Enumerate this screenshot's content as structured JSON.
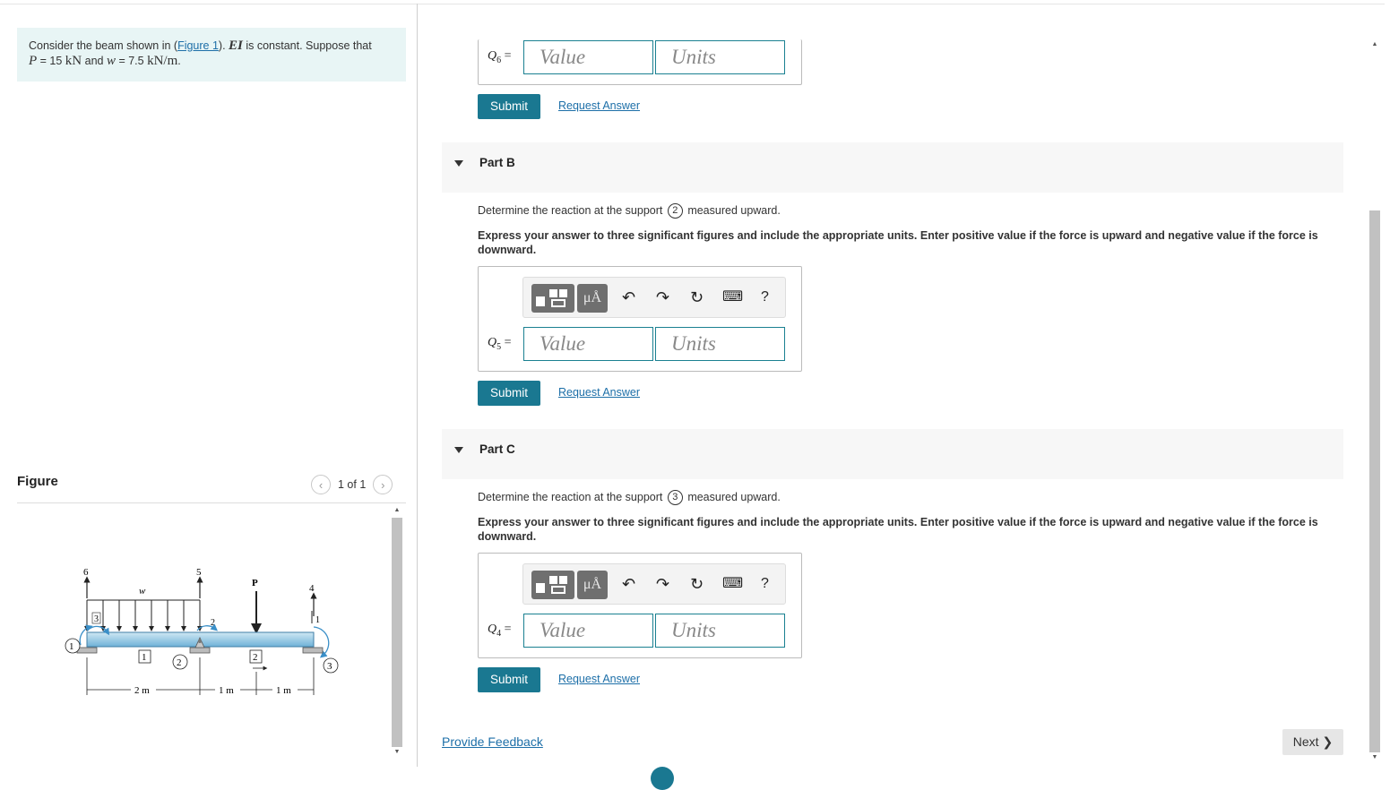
{
  "problem": {
    "text_prefix": "Consider the beam shown in (",
    "figure_link": "Figure 1",
    "text_mid": "). ",
    "ei": "EI",
    "text_constant": " is constant. Suppose that",
    "p_var": "P",
    "p_value": " = 15 ",
    "p_unit": "kN",
    "and_text": " and ",
    "w_var": "w",
    "w_value": " = 7.5 ",
    "w_unit": "kN/m",
    "end": "."
  },
  "figure": {
    "title": "Figure",
    "pager_text": "1 of 1",
    "prev_icon": "chevron-left-icon",
    "next_icon": "chevron-right-icon",
    "labels": {
      "node_6": "6",
      "node_5": "5",
      "node_4": "4",
      "node_3": "3",
      "node_2": "2",
      "node_1": "1",
      "w": "w",
      "P": "P",
      "support_1": "1",
      "support_2": "2",
      "support_3": "3",
      "elem_1": "1",
      "elem_2": "2",
      "dim_1": "2 m",
      "dim_2": "1 m",
      "dim_3": "1 m"
    }
  },
  "partA_tail": {
    "q_label": "Q",
    "q_sub": "6",
    "value_placeholder": "Value",
    "units_placeholder": "Units",
    "submit": "Submit",
    "request": "Request Answer"
  },
  "partB": {
    "title": "Part B",
    "q_pre": "Determine the reaction at the support ",
    "q_circ": "2",
    "q_post": " measured upward.",
    "instructions": "Express your answer to three significant figures and include the appropriate units. Enter positive value if the force is upward and negative value if the force is downward.",
    "q_label": "Q",
    "q_sub": "5",
    "value_placeholder": "Value",
    "units_placeholder": "Units",
    "submit": "Submit",
    "request": "Request Answer"
  },
  "partC": {
    "title": "Part C",
    "q_pre": "Determine the reaction at the support ",
    "q_circ": "3",
    "q_post": " measured upward.",
    "instructions": "Express your answer to three significant figures and include the appropriate units. Enter positive value if the force is upward and negative value if the force is downward.",
    "q_label": "Q",
    "q_sub": "4",
    "value_placeholder": "Value",
    "units_placeholder": "Units",
    "submit": "Submit",
    "request": "Request Answer"
  },
  "toolbar": {
    "units_button": "μÅ",
    "help": "?",
    "icons": [
      "templates-icon",
      "units-icon",
      "undo-icon",
      "redo-icon",
      "reset-icon",
      "keyboard-icon",
      "help-icon"
    ]
  },
  "footer": {
    "feedback": "Provide Feedback",
    "next": "Next"
  }
}
